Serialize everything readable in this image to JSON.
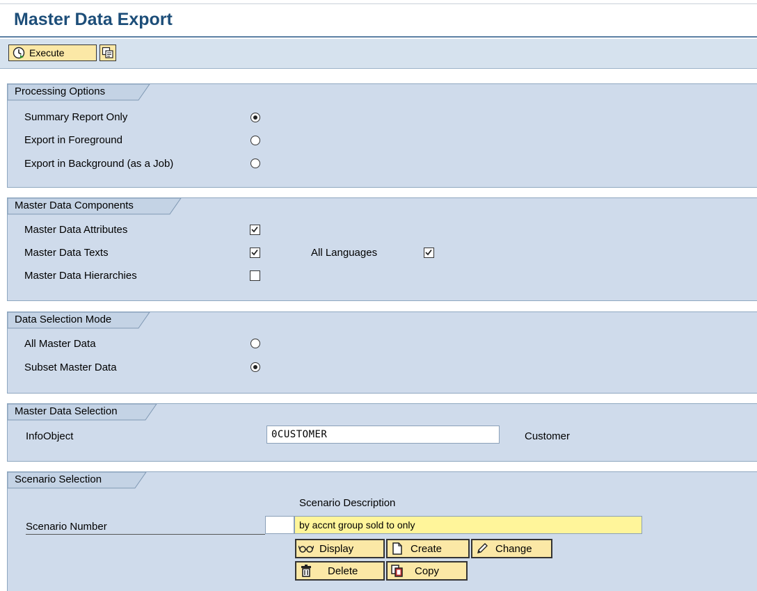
{
  "page": {
    "title": "Master Data Export"
  },
  "toolbar": {
    "execute_label": "Execute"
  },
  "processing_options": {
    "title": "Processing Options",
    "options": [
      {
        "label": "Summary Report Only",
        "selected": true
      },
      {
        "label": "Export in Foreground",
        "selected": false
      },
      {
        "label": "Export in Background (as a Job)",
        "selected": false
      }
    ]
  },
  "components": {
    "title": "Master Data Components",
    "attributes_label": "Master Data Attributes",
    "attributes_checked": true,
    "texts_label": "Master Data Texts",
    "texts_checked": true,
    "all_languages_label": "All Languages",
    "all_languages_checked": true,
    "hierarchies_label": "Master Data Hierarchies",
    "hierarchies_checked": false
  },
  "selection_mode": {
    "title": "Data Selection Mode",
    "options": [
      {
        "label": "All Master Data",
        "selected": false
      },
      {
        "label": "Subset Master Data",
        "selected": true
      }
    ]
  },
  "data_selection": {
    "title": "Master Data Selection",
    "infoobject_label": "InfoObject",
    "infoobject_value": "0CUSTOMER",
    "infoobject_text": "Customer"
  },
  "scenario": {
    "title": "Scenario Selection",
    "description_header": "Scenario Description",
    "number_label": "Scenario Number",
    "number_value": "",
    "description_value": "by accnt group sold to only",
    "buttons": {
      "display": "Display",
      "create": "Create",
      "change": "Change",
      "delete": "Delete",
      "copy": "Copy"
    }
  },
  "colors": {
    "title": "#1d4e79",
    "panel": "#cfdbeb",
    "button": "#fbe8a6",
    "highlight_field": "#fff59a"
  },
  "icons": [
    "execute-icon",
    "variant-icon",
    "display-icon",
    "create-icon",
    "change-icon",
    "delete-icon",
    "copy-icon"
  ]
}
